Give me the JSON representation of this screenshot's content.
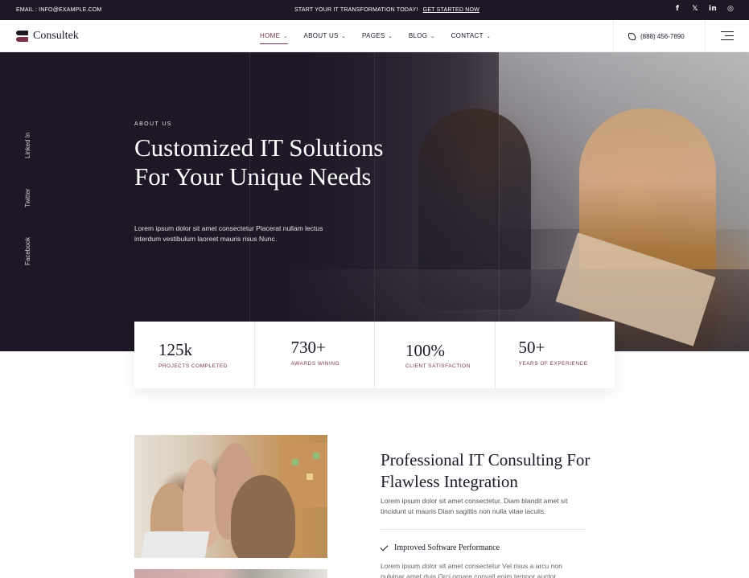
{
  "topbar": {
    "email": "EMAIL : INFO@EXAMPLE.COM",
    "promo": "START YOUR IT TRANSFORMATION TODAY!",
    "cta": "GET STARTED NOW",
    "socials": [
      {
        "icon": "facebook-icon",
        "glyph": "f"
      },
      {
        "icon": "x-icon",
        "glyph": "𝕏"
      },
      {
        "icon": "linkedin-icon",
        "glyph": "in"
      },
      {
        "icon": "instagram-icon",
        "glyph": "◎"
      }
    ]
  },
  "header": {
    "logo": "Consultek",
    "nav": [
      {
        "label": "HOME",
        "active": true
      },
      {
        "label": "ABOUT US"
      },
      {
        "label": "PAGES"
      },
      {
        "label": "BLOG"
      },
      {
        "label": "CONTACT"
      }
    ],
    "phone": "(888) 456-7890"
  },
  "hero": {
    "side_links": [
      "Linked In",
      "Twitter",
      "Facebook"
    ],
    "eyebrow": "ABOUT US",
    "title": "Customized IT Solutions For Your Unique Needs",
    "lead": "Lorem ipsum dolor sit amet consectetur Placerat nullam lectus interdum vestibulum laoreet mauris risus Nunc."
  },
  "stats": [
    {
      "value": "125k",
      "label": "PROJECTS COMPLETED"
    },
    {
      "value": "730+",
      "label": "AWARDS WINING"
    },
    {
      "value": "100%",
      "label": "CLIENT SATISFACTION"
    },
    {
      "value": "50+",
      "label": "YEARS OF EXPERIENCE"
    }
  ],
  "section": {
    "title": "Professional IT Consulting For Flawless Integration",
    "desc": "Lorem ipsum dolor sit amet consectetur. Diam blandit amet sit tincidunt ut mauris Diam sagittis non nulla vitae iaculis.",
    "feature": "Improved Software Performance",
    "feature_desc": "Lorem ipsum dolor sit amet consectetur Vel risus a arcu non pulvinar amet duis Orci ornare convall enim tempor auctor."
  },
  "colors": {
    "dark": "#1d1726",
    "accent": "#7a3448"
  }
}
